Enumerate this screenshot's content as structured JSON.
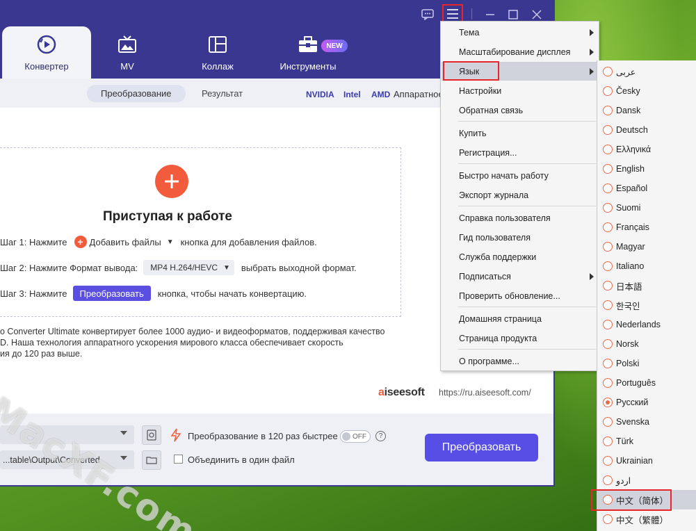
{
  "tabs": [
    {
      "label": "Конвертер",
      "icon": "converter-icon"
    },
    {
      "label": "MV",
      "icon": "tv-icon"
    },
    {
      "label": "Коллаж",
      "icon": "collage-icon"
    },
    {
      "label": "Инструменты",
      "icon": "toolbox-icon"
    }
  ],
  "new_badge": "NEW",
  "subtabs": {
    "convert": "Преобразование",
    "result": "Результат"
  },
  "hw": {
    "nvidia": "NVIDIA",
    "intel": "Intel",
    "amd": "AMD",
    "label": "Аппаратное"
  },
  "main": {
    "title": "Приступая к работе",
    "step1_prefix": "Шаг 1: Нажмите",
    "step1_button": "Добавить файлы",
    "step1_suffix": "кнопка для добавления файлов.",
    "step2_prefix": "Шаг 2: Нажмите Формат вывода:",
    "step2_format": "MP4 H.264/HEVC",
    "step2_suffix": "выбрать выходной формат.",
    "step3_prefix": "Шаг 3: Нажмите",
    "step3_button": "Преобразовать",
    "step3_suffix": "кнопка, чтобы начать конвертацию.",
    "desc1": "о Converter Ultimate конвертирует более 1000 аудио- и видеоформатов, поддерживая качество",
    "desc2": "D. Наша технология аппаратного ускорения мирового класса обеспечивает скорость",
    "desc3": "ия до 120 раз выше.",
    "logo_a": "a",
    "logo_rest": "iseesoft",
    "url": "https://ru.aiseesoft.com/"
  },
  "bottom": {
    "output_path": "...table\\Output\\Converted",
    "speed_text": "Преобразование в 120 раз быстрее",
    "toggle": "OFF",
    "help": "?",
    "merge_text": "Объединить в один файл",
    "convert_button": "Преобразовать"
  },
  "menu": {
    "items": [
      "Тема",
      "Масштабирование дисплея",
      "Язык",
      "Настройки",
      "Обратная связь",
      "Купить",
      "Регистрация...",
      "Быстро начать работу",
      "Экспорт журнала",
      "Справка пользователя",
      "Гид пользователя",
      "Служба поддержки",
      "Подписаться",
      "Проверить обновление...",
      "Домашняя страница",
      "Страница продукта",
      "О программе..."
    ]
  },
  "languages": [
    "عربى",
    "Česky",
    "Dansk",
    "Deutsch",
    "Ελληνικά",
    "English",
    "Español",
    "Suomi",
    "Français",
    "Magyar",
    "Italiano",
    "日本語",
    "한국인",
    "Nederlands",
    "Norsk",
    "Polski",
    "Português",
    "Русский",
    "Svenska",
    "Türk",
    "Ukrainian",
    "اردو",
    "中文（简体）",
    "中文（繁體）"
  ],
  "selected_language": "Русский",
  "watermark": "MacXF.com",
  "colors": {
    "accent": "#574ee6",
    "topbar": "#3a3791",
    "add": "#f25c3c",
    "highlight": "#e8262a"
  }
}
